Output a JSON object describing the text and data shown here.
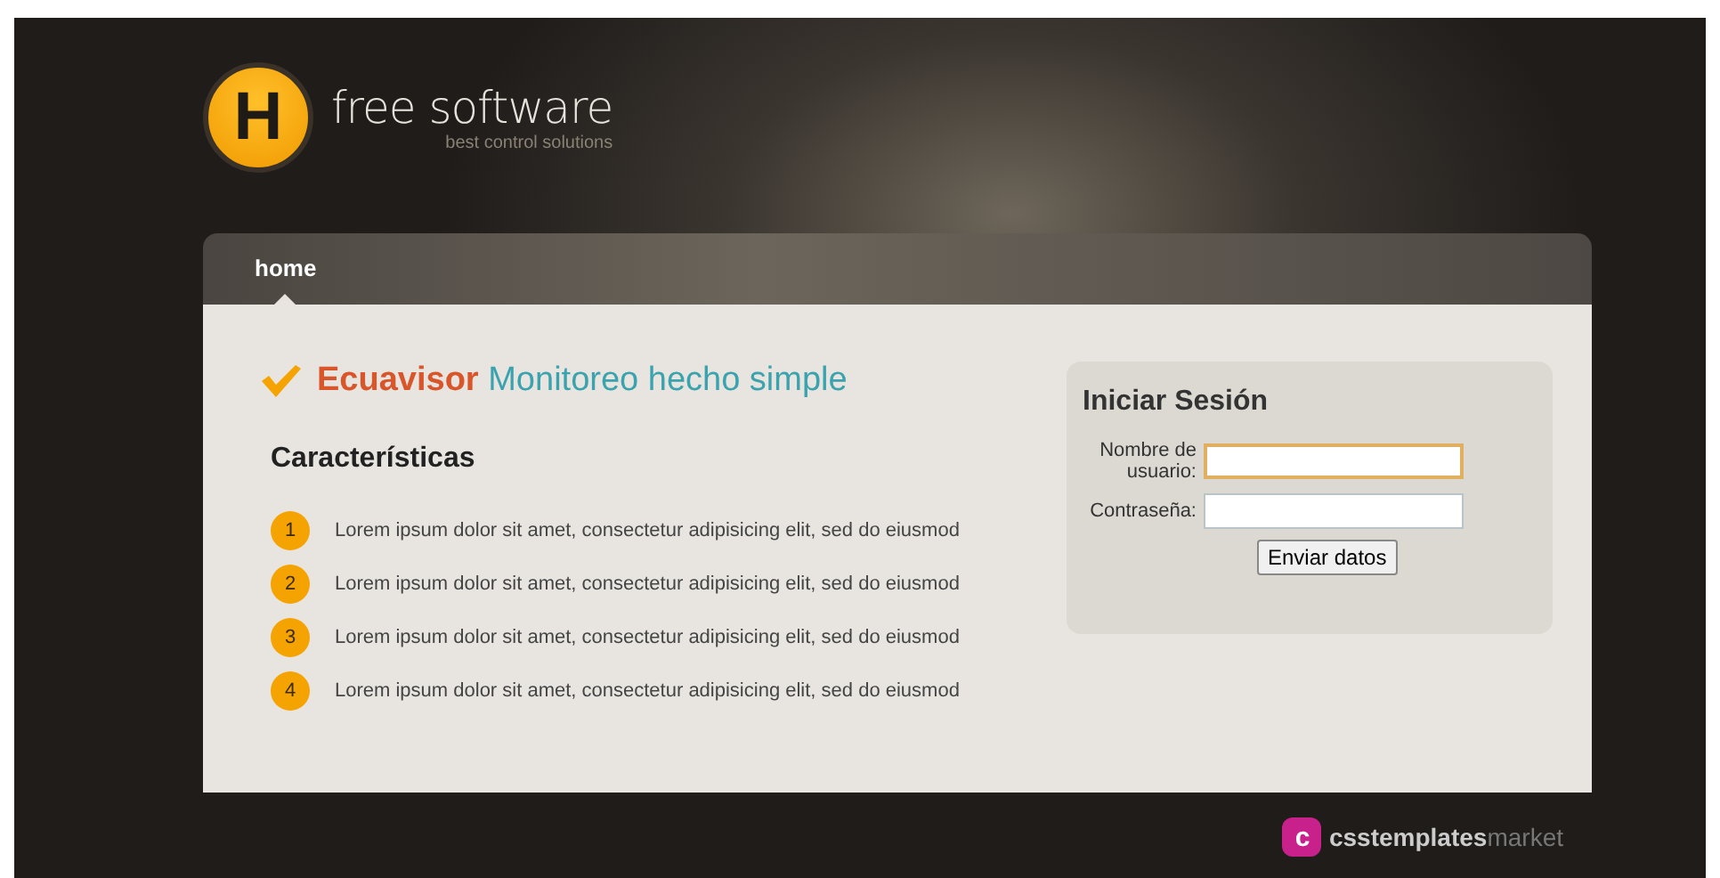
{
  "logo": {
    "letter": "H",
    "name": "free software",
    "tagline": "best control solutions"
  },
  "nav": [
    {
      "label": "home",
      "selected": true
    }
  ],
  "headline": {
    "brand": "Ecuavisor",
    "slogan": "Monitoreo hecho simple"
  },
  "features": {
    "title": "Características",
    "items": [
      {
        "number": "1",
        "text": "Lorem ipsum dolor sit amet, consectetur adipisicing elit, sed do eiusmod"
      },
      {
        "number": "2",
        "text": "Lorem ipsum dolor sit amet, consectetur adipisicing elit, sed do eiusmod"
      },
      {
        "number": "3",
        "text": "Lorem ipsum dolor sit amet, consectetur adipisicing elit, sed do eiusmod"
      },
      {
        "number": "4",
        "text": "Lorem ipsum dolor sit amet, consectetur adipisicing elit, sed do eiusmod"
      }
    ]
  },
  "login": {
    "title": "Iniciar Sesión",
    "fields": [
      {
        "label": "Nombre de usuario:",
        "focused": true
      },
      {
        "label": "Contraseña:",
        "focused": false
      }
    ],
    "button": "Enviar datos"
  },
  "footer": {
    "letter": "c",
    "brand": "csstemplates",
    "suffix": "market"
  }
}
